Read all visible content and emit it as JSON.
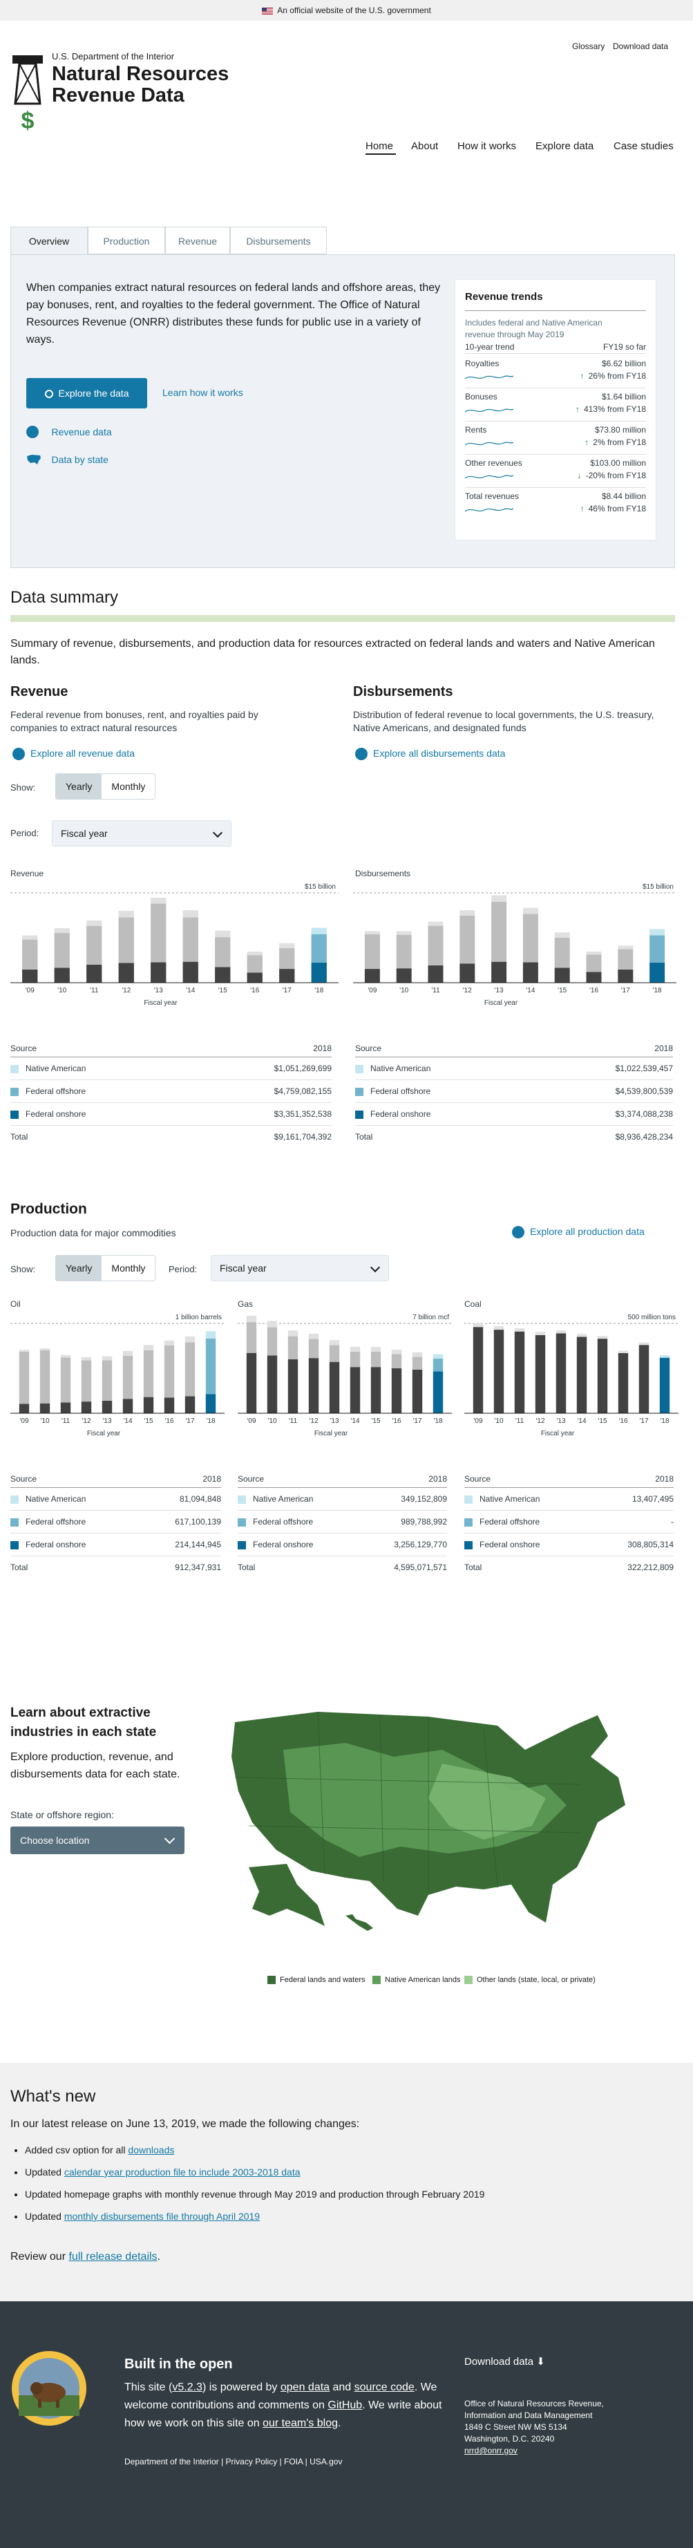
{
  "banner": {
    "text": "An official website of the U.S. government"
  },
  "header": {
    "glossary": "Glossary",
    "download": "Download data",
    "department": "U.S. Department of the Interior",
    "site_name_line1": "Natural Resources",
    "site_name_line2": "Revenue Data",
    "nav": [
      "Home",
      "About",
      "How it works",
      "Explore data",
      "Case studies"
    ]
  },
  "overview": {
    "tabs": [
      "Overview",
      "Production",
      "Revenue",
      "Disbursements"
    ],
    "intro": "When companies extract natural resources on federal lands and offshore areas, they pay bonuses, rent, and royalties to the federal government. The Office of Natural Resources Revenue (ONRR) distributes these funds for public use in a variety of ways.",
    "explore_button": "Explore the data",
    "learn_link": "Learn how it works",
    "revenue_link": "Revenue data",
    "state_link": "Data by state",
    "trends": {
      "title": "Revenue trends",
      "subtitle": "Includes federal and Native American revenue through May 2019",
      "col1": "10-year trend",
      "col2": "FY19 so far",
      "rows": [
        {
          "name": "Royalties",
          "value": "$6.62 billion",
          "change": "26% from FY18",
          "dir": "up"
        },
        {
          "name": "Bonuses",
          "value": "$1.64 billion",
          "change": "413% from FY18",
          "dir": "up"
        },
        {
          "name": "Rents",
          "value": "$73.80 million",
          "change": "2% from FY18",
          "dir": "up"
        },
        {
          "name": "Other revenues",
          "value": "$103.00 million",
          "change": "-20% from FY18",
          "dir": "down"
        },
        {
          "name": "Total revenues",
          "value": "$8.44 billion",
          "change": "46% from FY18",
          "dir": "up"
        }
      ]
    }
  },
  "summary": {
    "title": "Data summary",
    "intro": "Summary of revenue, disbursements, and production data for resources extracted on federal lands and waters and Native American lands.",
    "revenue": {
      "title": "Revenue",
      "desc": "Federal revenue from bonuses, rent, and royalties paid by companies to extract natural resources",
      "link": "Explore all revenue data"
    },
    "disbursements": {
      "title": "Disbursements",
      "desc": "Distribution of federal revenue to local governments, the U.S. treasury, Native Americans, and designated funds",
      "link": "Explore all disbursements data"
    },
    "show_label": "Show:",
    "yearly": "Yearly",
    "monthly": "Monthly",
    "period_label": "Period:",
    "period_value": "Fiscal year"
  },
  "chart_data": [
    {
      "type": "bar",
      "title": "Revenue",
      "max_label": "$15 billion",
      "xlabel": "Fiscal year",
      "categories": [
        "'09",
        "'10",
        "'11",
        "'12",
        "'13",
        "'14",
        "'15",
        "'16",
        "'17",
        "'18"
      ],
      "ylim": [
        0,
        15
      ],
      "series": [
        {
          "name": "Federal onshore",
          "values": [
            2.2,
            2.5,
            3.0,
            3.3,
            3.4,
            3.5,
            2.6,
            1.7,
            2.3,
            3.35
          ]
        },
        {
          "name": "Federal offshore",
          "values": [
            5.0,
            5.8,
            6.5,
            7.6,
            9.8,
            7.4,
            5.0,
            2.9,
            3.5,
            4.76
          ]
        },
        {
          "name": "Native American",
          "values": [
            0.7,
            0.8,
            0.9,
            1.1,
            1.0,
            1.2,
            1.1,
            0.6,
            0.8,
            1.05
          ]
        }
      ]
    },
    {
      "type": "bar",
      "title": "Disbursements",
      "max_label": "$15 billion",
      "xlabel": "Fiscal year",
      "categories": [
        "'09",
        "'10",
        "'11",
        "'12",
        "'13",
        "'14",
        "'15",
        "'16",
        "'17",
        "'18"
      ],
      "ylim": [
        0,
        15
      ],
      "series": [
        {
          "name": "Federal onshore",
          "values": [
            2.3,
            2.4,
            2.9,
            3.2,
            3.5,
            3.4,
            2.5,
            1.8,
            2.2,
            3.37
          ]
        },
        {
          "name": "Federal offshore",
          "values": [
            5.8,
            5.6,
            6.6,
            8.0,
            10.0,
            8.1,
            5.0,
            2.9,
            3.4,
            4.54
          ]
        },
        {
          "name": "Native American",
          "values": [
            0.5,
            0.6,
            0.7,
            0.9,
            1.1,
            1.0,
            0.9,
            0.5,
            0.6,
            1.02
          ]
        }
      ]
    },
    {
      "type": "bar",
      "title": "Oil",
      "max_label": "1 billion barrels",
      "xlabel": "Fiscal year",
      "categories": [
        "'09",
        "'10",
        "'11",
        "'12",
        "'13",
        "'14",
        "'15",
        "'16",
        "'17",
        "'18"
      ],
      "ylim": [
        0,
        1000
      ],
      "series": [
        {
          "name": "Federal onshore",
          "values": [
            105,
            110,
            120,
            130,
            140,
            160,
            180,
            175,
            190,
            214
          ]
        },
        {
          "name": "Federal offshore",
          "values": [
            580,
            590,
            500,
            460,
            450,
            480,
            520,
            580,
            600,
            617
          ]
        },
        {
          "name": "Native American",
          "values": [
            20,
            22,
            28,
            35,
            45,
            55,
            60,
            55,
            65,
            81
          ]
        }
      ]
    },
    {
      "type": "bar",
      "title": "Gas",
      "max_label": "7 billion mcf",
      "xlabel": "Fiscal year",
      "categories": [
        "'09",
        "'10",
        "'11",
        "'12",
        "'13",
        "'14",
        "'15",
        "'16",
        "'17",
        "'18"
      ],
      "ylim": [
        0,
        7
      ],
      "series": [
        {
          "name": "Federal onshore",
          "values": [
            4.7,
            4.5,
            4.2,
            4.3,
            4.0,
            3.6,
            3.6,
            3.5,
            3.4,
            3.26
          ]
        },
        {
          "name": "Federal offshore",
          "values": [
            2.4,
            2.2,
            1.8,
            1.5,
            1.3,
            1.2,
            1.2,
            1.1,
            1.0,
            0.99
          ]
        },
        {
          "name": "Native American",
          "values": [
            0.5,
            0.5,
            0.45,
            0.4,
            0.4,
            0.38,
            0.37,
            0.35,
            0.35,
            0.35
          ]
        }
      ]
    },
    {
      "type": "bar",
      "title": "Coal",
      "max_label": "500 million tons",
      "xlabel": "Fiscal year",
      "categories": [
        "'09",
        "'10",
        "'11",
        "'12",
        "'13",
        "'14",
        "'15",
        "'16",
        "'17",
        "'18"
      ],
      "ylim": [
        0,
        500
      ],
      "series": [
        {
          "name": "Federal onshore",
          "values": [
            480,
            465,
            455,
            435,
            445,
            425,
            415,
            335,
            380,
            309
          ]
        },
        {
          "name": "Federal offshore",
          "values": [
            0,
            0,
            0,
            0,
            0,
            0,
            0,
            0,
            0,
            0
          ]
        },
        {
          "name": "Native American",
          "values": [
            20,
            20,
            18,
            18,
            16,
            16,
            15,
            13,
            14,
            13
          ]
        }
      ]
    }
  ],
  "tables": {
    "source": "Source",
    "year": "2018",
    "revenue": [
      [
        "Native American",
        "$1,051,269,699"
      ],
      [
        "Federal offshore",
        "$4,759,082,155"
      ],
      [
        "Federal onshore",
        "$3,351,352,538"
      ]
    ],
    "revenue_total": "$9,161,704,392",
    "disb": [
      [
        "Native American",
        "$1,022,539,457"
      ],
      [
        "Federal offshore",
        "$4,539,800,539"
      ],
      [
        "Federal onshore",
        "$3,374,088,238"
      ]
    ],
    "disb_total": "$8,936,428,234",
    "oil": [
      [
        "Native American",
        "81,094,848"
      ],
      [
        "Federal offshore",
        "617,100,139"
      ],
      [
        "Federal onshore",
        "214,144,945"
      ]
    ],
    "oil_total": "912,347,931",
    "gas": [
      [
        "Native American",
        "349,152,809"
      ],
      [
        "Federal offshore",
        "989,788,992"
      ],
      [
        "Federal onshore",
        "3,256,129,770"
      ]
    ],
    "gas_total": "4,595,071,571",
    "coal": [
      [
        "Native American",
        "13,407,495"
      ],
      [
        "Federal offshore",
        "-"
      ],
      [
        "Federal onshore",
        "308,805,314"
      ]
    ],
    "coal_total": "322,212,809",
    "total_label": "Total"
  },
  "production": {
    "title": "Production",
    "desc": "Production data for major commodities",
    "link": "Explore all production data"
  },
  "colors": {
    "native": "#c3e6f0",
    "offshore": "#72b4cc",
    "onshore": "#086996",
    "gray_light": "#bdbdbd",
    "gray_dark": "#424242"
  },
  "states": {
    "title": "Learn about extractive industries in each state",
    "desc": "Explore production, revenue, and disbursements data for each state.",
    "select_label": "State or offshore region:",
    "select_value": "Choose location",
    "legend": [
      "Federal lands and waters",
      "Native American lands",
      "Other lands (state, local, or private)"
    ]
  },
  "whatsnew": {
    "title": "What's new",
    "intro": "In our latest release on June 13, 2019, we made the following changes:",
    "items": [
      {
        "pre": "Added csv option for all ",
        "link": "downloads",
        "post": ""
      },
      {
        "pre": "Updated ",
        "link": "calendar year production file to include 2003-2018 data",
        "post": ""
      },
      {
        "pre": "Updated homepage graphs with monthly revenue through May 2019 and production through February 2019",
        "link": "",
        "post": ""
      },
      {
        "pre": "Updated ",
        "link": "monthly disbursements file through April 2019",
        "post": ""
      }
    ],
    "review_pre": "Review our ",
    "review_link": "full release details",
    "review_post": "."
  },
  "footer": {
    "title": "Built in the open",
    "p1": "This site (",
    "version": "v5.2.3",
    "p2": ") is powered by ",
    "open_data": "open data",
    "p3": " and ",
    "source_code": "source code",
    "p4": ". We welcome contributions and comments on ",
    "github": "GitHub",
    "p5": ". We write about how we work on this site on ",
    "blog": "our team's blog",
    "p6": ".",
    "links": "Department of the Interior | Privacy Policy | FOIA | USA.gov",
    "download": "Download data",
    "address": [
      "Office of Natural Resources Revenue,",
      "Information and Data Management",
      "1849 C Street NW MS 5134",
      "Washington, D.C. 20240"
    ],
    "email": "nrrd@onrr.gov"
  }
}
